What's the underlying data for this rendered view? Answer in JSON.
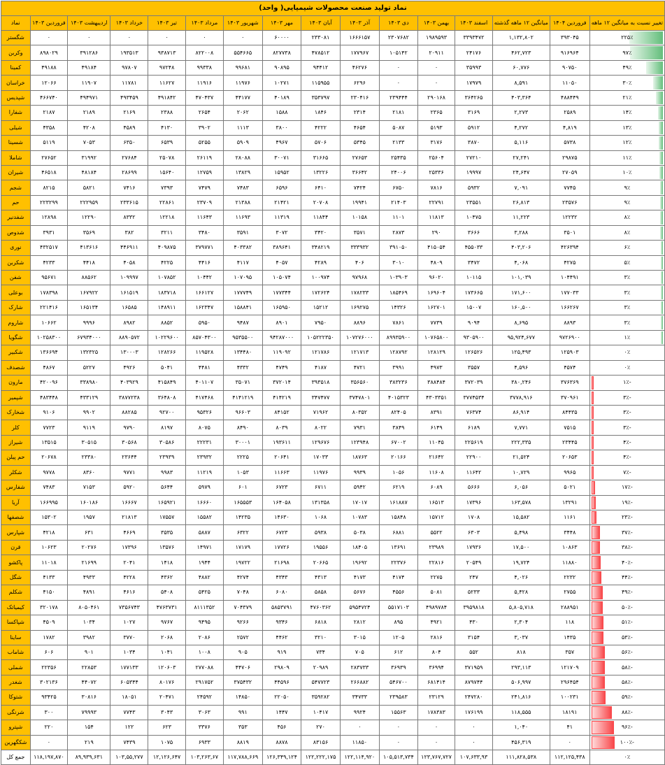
{
  "title": "نماد تولید صنعت محصولات شیمیایی( واحد)",
  "headers": [
    "تغییر نسبت به میانگین ۱۲ ماهه",
    "فروردین ۱۴۰۴",
    "میانگین ۱۲ ماهه گذشته",
    "اسفند ۱۴۰۳",
    "بهمن ۱۴۰۳",
    "دی ۱۴۰۳",
    "آذر ۱۴۰۳",
    "آبان ۱۴۰۳",
    "مهر ۱۴۰۳",
    "شهریور ۱۴۰۳",
    "مرداد ۱۴۰۳",
    "تیر ۱۴۰۳",
    "خرداد ۱۴۰۳",
    "اردیبهشت ۱۴۰۳",
    "فروردین ۱۴۰۳",
    "نماد"
  ],
  "rows": [
    {
      "change": "۲۲۵٪",
      "change_value": 225,
      "values": [
        "۳۹۳۰۴۵",
        "۱,۱۳۲,۸۰۲",
        "۳۳۹۳۴۷۲",
        "۱۹۸۹۵۹۳",
        "۲۳۰۷۶۸۲",
        "۱۶۶۶۱۵۷",
        "۲۳۳۰۸۱",
        "۶۰۰۰۰",
        "۰",
        "۰",
        "۰",
        "۰",
        "۰",
        "۰"
      ],
      "name": "شگستر"
    },
    {
      "change": "۹۷٪",
      "change_value": 97,
      "values": [
        "۹۱۶۹۶۴",
        "۴۶۲,۷۲۳",
        "۲۴۱۷۶",
        "۲۰۹۱۱",
        "۱۰۵۱۴۲",
        "۱۷۷۹۶۷",
        "۴۷۸۵۱۲",
        "۸۲۷۷۳۸",
        "۵۵۴۶۶۵",
        "۸۲۲۰۰۸",
        "۹۳۸۷۱۳",
        "۱۹۳۵۱۳",
        "۳۹۱۲۸۶",
        "۸۹۸۰۲۹"
      ],
      "name": "وکربن"
    },
    {
      "change": "۴۹٪",
      "change_value": 49,
      "values": [
        "۹۰۷۵۰",
        "۶۰,۷۷۶",
        "۳۵۹۹۳",
        "۰",
        "۰",
        "۴۶۲۷۶",
        "۹۴۴۱۲",
        "۹۰۸۹۵",
        "۹۹۶۸۱",
        "۹۹۳۳۸",
        "۹۷۲۴۸",
        "۹۷۸۰۷",
        "۴۹۱۸۴",
        "۴۹۱۸۸"
      ],
      "name": "کمینا"
    },
    {
      "change": "۳۰٪",
      "change_value": 30,
      "values": [
        "۱۱۰۵۰",
        "۸,۵۹۱",
        "۱۷۹۷۹",
        "۰",
        "۰",
        "۶۲۹۶",
        "۱۱۵۹۵۵",
        "۱۰۲۷۱",
        "۱۱۹۷۶",
        "۱۱۹۱۶",
        "۱۱۶۲۷",
        "۱۱۷۸۱",
        "۱۱۹۰۷",
        "۱۲۰۶۶"
      ],
      "name": "خراسان"
    },
    {
      "change": "۲۱٪",
      "change_value": 21,
      "values": [
        "۴۸۸۴۴۹",
        "۴۰۳,۳۶۴",
        "۳۶۴۲۶۵",
        "۲۹۰۱۶۸",
        "۲۳۹۴۴۴",
        "۲۳۰۴۱۶",
        "۳۵۳۷۹۷",
        "۴۰۱۸۹",
        "۴۴۱۷۷",
        "۴۷۰۴۳۷",
        "۴۹۱۸۴۲",
        "۴۹۳۴۵۹",
        "۴۹۴۹۷۱",
        "۴۶۶۷۴۰"
      ],
      "name": "شپدیس"
    },
    {
      "change": "۱۴٪",
      "change_value": 14,
      "values": [
        "۲۵۸۹",
        "۲,۲۷۳",
        "۳۱۶۹",
        "۲۳۶۵",
        "۲۱۸۱",
        "۲۳۱۴",
        "۱۸۴۶",
        "۱۵۸۸",
        "۲۰۶۲",
        "۲۶۵۴",
        "۲۳۸۸",
        "۲۱۶۹",
        "۲۱۸۹",
        "۲۱۸۷"
      ],
      "name": "شفارا"
    },
    {
      "change": "۱۳٪",
      "change_value": 13,
      "values": [
        "۴,۸۱۹",
        "۴,۲۷۲",
        "۵۹۱۲",
        "۵۱۹۳",
        "۵۰۸۷",
        "۴۶۵۴",
        "۴۲۲۲",
        "۳۸۰۰",
        "۱۱۱۳",
        "۳۹۰۲",
        "۴۱۳۰",
        "۴۵۸۹",
        "۴۲۰۸",
        "۴۳۵۸"
      ],
      "name": "شیلی"
    },
    {
      "change": "۱۲٪",
      "change_value": 12,
      "values": [
        "۵۷۳۸",
        "۵,۱۱۶",
        "۳۸۷۰",
        "۳۱۷۶",
        "۲۱۳۳",
        "۵۳۴۵",
        "۵۷۰۶",
        "۴۹۶۷",
        "۵۹۰۹",
        "۵۲۵۵",
        "۶۵۳۹",
        "۶۳۵۰",
        "۷۰۵۳",
        "۵۱۱۹"
      ],
      "name": "شسینا"
    },
    {
      "change": "۱۱٪",
      "change_value": 11,
      "values": [
        "۲۹۸۷۵",
        "۲۷,۲۴۱",
        "۲۷۲۱۰",
        "۲۵۶۰۴",
        "۲۵۴۳۵",
        "۲۷۶۵۳",
        "۳۱۶۶۵",
        "۳۰۰۷۱",
        "۲۸۰۸۸",
        "۲۶۱۱۹",
        "۲۵۰۷۸",
        "۲۷۶۸۴",
        "۳۱۹۹۲",
        "۲۷۶۵۲"
      ],
      "name": "شاملا"
    },
    {
      "change": "۱۰٪",
      "change_value": 10,
      "values": [
        "۲۷۰۵۹",
        "۲۴,۶۴۷",
        "۱۹۹۹۷",
        "۲۵۳۳۶",
        "۲۴۰۰۶",
        "۳۶۶۴۲",
        "۱۳۲۲۶",
        "۱۵۹۵۲",
        "۱۳۸۲۹",
        "۱۲۷۵۹",
        "۱۵۶۴۰",
        "۲۸۶۹۹",
        "۴۸۱۸۴",
        "۴۶۵۱۸"
      ],
      "name": "شیران"
    },
    {
      "change": "۹٪",
      "change_value": 9,
      "values": [
        "۷۷۴۵",
        "۷,۰۹۱",
        "۵۹۳۲",
        "۷۸۱۶",
        "۶۷۵۰",
        "۷۴۲۴",
        "۶۴۱۰",
        "۶۵۹۶",
        "۷۴۸۳",
        "۷۴۷۹",
        "۷۳۹۳",
        "۷۴۱۶",
        "۵۸۲۱",
        "۸۲۱۵"
      ],
      "name": "شجم"
    },
    {
      "change": "۹٪",
      "change_value": 9,
      "values": [
        "۲۳۵۷۶",
        "۲۶,۸۱۳",
        "۲۳۵۵۱",
        "۲۲۷۹۱",
        "۲۱۴۰۳",
        "۱۹۹۴۱",
        "۲۰۷۰۸",
        "۲۱۴۲۱",
        "۲۱۳۸۸",
        "۲۳۷۰۹",
        "۲۲۸۶۱",
        "۲۳۳۶۱۵",
        "۲۲۲۹۵۹",
        "۲۲۳۲۹۹"
      ],
      "name": "حم"
    },
    {
      "change": "۸٪",
      "change_value": 8,
      "values": [
        "۱۲۲۳۲",
        "۱۱,۲۲۳",
        "۱۰۴۷۵",
        "۱۱۸۱۳",
        "۱۱۰۱",
        "۱۰۱۵۸",
        "۱۱۸۴۴",
        "۱۱۳۱۹",
        "۱۱۶۹۳",
        "۱۱۶۴۳",
        "۱۲۲۱۸",
        "۸۳۳۲",
        "۱۲۲۹۰",
        "۱۲۸۹۸"
      ],
      "name": "شفدنیر"
    },
    {
      "change": "۸٪",
      "change_value": 8,
      "values": [
        "۳۵۰۱",
        "۳,۲۸۸",
        "۳۶۶۶",
        "۲۹۰",
        "۲۸۷۳",
        "۳۵۷۱",
        "۳۴۲۰",
        "۳۰۷۲",
        "۳۵۹۱",
        "۳۴۸۰",
        "۳۲۱۱",
        "۳۸۲",
        "۳۵۶۹",
        "۳۹۳۱"
      ],
      "name": "شدوص"
    },
    {
      "change": "۶٪",
      "change_value": 6,
      "values": [
        "۴۲۶۳۹۴",
        "۴۰۳,۲۰۶",
        "۴۵۵۰۳۳",
        "۴۱۵۰۵۴",
        "۳۹۱۰۵۰",
        "۳۳۳۹۳۲",
        "۳۴۸۲۱۹",
        "۳۸۹۶۴۱",
        "۴۰۳۳۸۲",
        "۳۷۹۷۷۱",
        "۴۰۹۸۷۵",
        "۴۴۶۹۱۱",
        "۴۱۳۶۱۶",
        "۴۳۲۵۱۷"
      ],
      "name": "نوری"
    },
    {
      "change": "۵٪",
      "change_value": 5,
      "values": [
        "۴۲۷۵",
        "۴,۰۶۸",
        "۳۴۷۲",
        "۴۸۰۹",
        "۳۰۱۰",
        "۴۰۶",
        "۴۲۸۹",
        "۴۰۵۷",
        "۴۱۱۷",
        "۴۴۱۶",
        "۴۲۲۵",
        "۴۰۵۸",
        "۴۴۱۸",
        "۴۲۳۳"
      ],
      "name": "شکربن"
    },
    {
      "change": "۳٪",
      "change_value": 3,
      "values": [
        "۱۰۴۴۹۱",
        "۱۰۱,۰۳۹",
        "۱۰۱۱۵",
        "۹۶۰۲۰",
        "۱۰۳۹۰۳",
        "۹۷۹۶۸",
        "۱۰۰۹۷۴",
        "۱۰۵۰۷۴",
        "۱۰۷۰۹۵",
        "۱۰۴۴۲",
        "۱۰۷۸۵۲",
        "۱۰۹۹۹۷",
        "۸۸۵۶۲",
        "۹۵۶۷۱"
      ],
      "name": "شفن"
    },
    {
      "change": "۳٪",
      "change_value": 3,
      "values": [
        "۱۷۷۰۳۳",
        "۱۷۱,۶۰۰",
        "۱۷۳۶۶۵",
        "۱۶۹۶۰۴",
        "۱۸۵۴۶۹",
        "۱۷۸۲۳۳",
        "۱۷۲۶۲۴",
        "۱۷۷۳۴۴",
        "۱۷۷۷۴۹",
        "۱۶۶۱۲۷",
        "۱۸۳۷۱۸",
        "۱۶۱۵۱۹",
        "۱۶۷۹۲۲",
        "۱۷۸۳۹۸"
      ],
      "name": "بوعلی"
    },
    {
      "change": "۳٪",
      "change_value": 3,
      "values": [
        "۱۶۶۲۶۷",
        "۱۶۰,۵۰۰",
        "۱۵۰۰۷",
        "۱۶۲۷۰۱",
        "۱۴۳۲۶",
        "۱۶۹۲۷۵",
        "۱۵۲۱۲",
        "۱۶۵۹۵۰",
        "۱۵۸۸۴۱",
        "۱۶۲۳۴۷",
        "۱۴۸۹۱۱",
        "۱۶۵۸۵",
        "۱۶۵۱۳۴",
        "۲۲۱۴۱۶"
      ],
      "name": "شارک"
    },
    {
      "change": "۳٪",
      "change_value": 3,
      "values": [
        "۸۸۹۳",
        "۸,۶۹۵",
        "۹۰۹۴",
        "۷۷۳۹",
        "۷۸۶۱",
        "۸۸۹۶",
        "۷۹۵۰",
        "۸۹۰۱",
        "۹۴۸۷",
        "۵۹۵۰",
        "۸۸۵۲",
        "۸۹۸۲",
        "۹۹۹۶",
        "۱۰۶۶۲"
      ],
      "name": "شاروم"
    },
    {
      "change": "۱٪",
      "change_value": 1,
      "values": [
        "۹۷۲۶۹۰۰",
        "۹۵,۹۲۴,۶۷۷",
        "۹۳۰۵۹۰۰",
        "۱۰۷۶۵۸۰۰",
        "۸۹۹۳۵۹۰۰",
        "۱۰۷۲۷۶۰۰۰",
        "۱۰۵۲۲۲۳۵۰",
        "۹۴۲۸۷۰۰۰",
        "۹۵۳۵۵۰۰",
        "۸۵۷۰۴۳۰۰",
        "۱۰۲۲۹۶۰۰",
        "۸۸۹۰۵۷۲",
        "۶۷۹۳۴۰۰۰",
        "۱۰۲۵۸۳۰۰"
      ],
      "name": "شگویا"
    },
    {
      "change": "۰٪",
      "change_value": 0,
      "values": [
        "۱۲۵۹۰۳",
        "۱۲۵,۴۹۳",
        "۱۲۶۵۲۶",
        "۱۲۸۱۲۹",
        "۱۲۸۷۹۲",
        "۱۲۱۷۱۳",
        "۱۲۱۷۸۶",
        "۱۱۹۰۹۲",
        "۱۳۴۴۸۰",
        "۱۱۹۵۲۸",
        "۱۲۸۲۶۶",
        "۱۳۰۰۰۳",
        "۱۳۲۳۲۵",
        "۱۳۶۶۹۴"
      ],
      "name": "شکبیر"
    },
    {
      "change": "۰٪",
      "change_value": 0,
      "values": [
        "۴۵۷۴",
        "۴,۵۹۶",
        "۳۵۵۷",
        "۴۹۷۳",
        "۳۹۹۱",
        "۴۷۲۱",
        "۴۱۸۷",
        "۴۷۴۹",
        "۴۳۳۲",
        "۴۴۸۱",
        "۵۰۴۱",
        "۴۹۲۶",
        "۵۲۲۷",
        "۴۸۶۷"
      ],
      "name": "شصدف"
    },
    {
      "change": "-۱٪",
      "change_value": -1,
      "values": [
        "۳۷۶۳۶۹",
        "۳۸۰,۲۴۶",
        "۳۷۲۰۳۹",
        "۳۸۸۴۸۴",
        "۳۸۳۲۳۶",
        "۳۵۶۵۶۰",
        "۳۹۳۵۱۸",
        "۳۷۲۰۱۴",
        "۳۵۰۷۱",
        "۴۰۱۱۰۷",
        "۴۱۵۸۴۹",
        "۴۰۳۹۲۹",
        "۳۳۸۹۸۰",
        "۴۲۰۰۹۶"
      ],
      "name": "مارون"
    },
    {
      "change": "-۳٪",
      "change_value": -3,
      "values": [
        "۳۷۰۹۶۱",
        "۳۷۷۸,۹۱۶",
        "۳۷۷۴۵۳۴",
        "۴۳۰۳۳۵۱",
        "۴۰۱۵۳۲۳",
        "۳۷۴۷۸۰۱",
        "۳۴۷۴۷۷",
        "۴۱۴۲۱۹",
        "۴۱۴۱۲۱۹",
        "۴۱۷۴۶۸",
        "۳۶۴۸۰۸",
        "۳۸۷۷۲۳۸",
        "۴۳۳۱۲۹",
        "۴۸۳۴۴۸"
      ],
      "name": "شپمیر"
    },
    {
      "change": "-۳٪",
      "change_value": -3,
      "values": [
        "۸۴۴۳۵",
        "۸۶,۹۱۴",
        "۷۶۳۷۴",
        "۸۳۹۱",
        "۸۲۴۰۵",
        "۸۰۳۵۲",
        "۷۱۹۶۲",
        "۸۴۱۵۲",
        "۹۶۶۰۳",
        "۹۵۳۲۶",
        "۹۲۷۰۰",
        "۸۸۲۸۵",
        "۹۹۰۲",
        "۹۱۰۶"
      ],
      "name": "شخارک"
    },
    {
      "change": "-۳٪",
      "change_value": -3,
      "values": [
        "۷۵۱۵",
        "۷,۷۷۱",
        "۶۱۸۹",
        "۶۱۴۹",
        "۳۸۴۹",
        "۷۹۳۱",
        "۸۰۲۲",
        "۸۰۳۹",
        "۸۴۹۰",
        "۸۰۷۵",
        "۸۱۹۷",
        "۹۷۹۰",
        "۹۱۱۹",
        "۷۷۲۳"
      ],
      "name": "کلر"
    },
    {
      "change": "-۴٪",
      "change_value": -4,
      "values": [
        "۲۳۴۴۵",
        "۲۲۲,۳۳۵",
        "۲۲۵۶۱۹",
        "۱۱۰۴۵",
        "۶۷۰۰۲",
        "۱۲۳۹۴۸",
        "۱۲۹۶۷۶",
        "۱۹۳۶۱۱",
        "۳۰۰۰۱",
        "۲۲۲۳۱",
        "۳۰۵۸۶",
        "۳۰۵۶۸",
        "۳۰۵۱۵",
        "۱۳۵۱۵"
      ],
      "name": "شیراز"
    },
    {
      "change": "-۴٪",
      "change_value": -4,
      "values": [
        "۲۰۶۵۳",
        "۲۱,۵۲۴",
        "۲۲۹۰۰",
        "۲۱۶۴۲",
        "۲۰۱۶۶",
        "۱۸۷۶۳",
        "۱۷۰۳۳",
        "۲۰۶۴۱",
        "۲۲۲۵",
        "۲۳۹۳۲",
        "۲۳۹۳۹",
        "۲۳۶۴۴",
        "۲۳۳۸۰",
        "۲۰۶۷۸"
      ],
      "name": "حم پیلن"
    },
    {
      "change": "-۷٪",
      "change_value": -7,
      "values": [
        "۹۹۶۵",
        "۱۰,۷۲۹",
        "۱۱۶۴۲",
        "۱۱۶۰۸",
        "۱۰۵۶",
        "۹۹۳۹",
        "۱۱۹۷۶",
        "۱۱۶۶۳",
        "۱۰۵۳",
        "۱۱۲۱۹",
        "۹۹۸۳",
        "۹۷۷۱",
        "۸۳۶۰",
        "۹۷۷۸"
      ],
      "name": "شکلر"
    },
    {
      "change": "-۱۷٪",
      "change_value": -17,
      "values": [
        "۵۰۲۱",
        "۶,۰۵۶",
        "۵۶۶۶",
        "۶۰۸۹",
        "۶۲۱۹",
        "۵۹۴۲",
        "۶۷۱۱",
        "۶۷۲۳",
        "۶۰۱",
        "۵۹۷۹",
        "۵۶۴۴",
        "۵۹۲۰",
        "۷۱۵۳",
        "۷۴۸۳"
      ],
      "name": "شفارس"
    },
    {
      "change": "-۱۹٪",
      "change_value": -19,
      "values": [
        "۱۳۲۹۱",
        "۱۶۳,۵۷۸",
        "۱۷۳۹۶",
        "۱۶۵۱۳",
        "۱۶۱۸۸۷",
        "۱۷۰۱۷",
        "۱۳۱۳۵۸",
        "۱۶۴۰۵۸",
        "۱۶۵۵۵۳",
        "۱۶۶۶۰",
        "۱۶۵۹۲۱",
        "۱۶۶۶۷",
        "۱۶۰۱۸۶",
        "۱۶۶۹۹۵"
      ],
      "name": "آریا"
    },
    {
      "change": "-۲۳٪",
      "change_value": -23,
      "values": [
        "۱۱۶۱",
        "۱۵,۵۸۲",
        "۱۷۰۸",
        "۱۵۷۱۲",
        "۱۵۸۴۸",
        "۱۰۷۸۳",
        "۱۰۶۸",
        "۱۴۶۳۰",
        "۱۴۲۳۵",
        "۱۵۵۸۲",
        "۱۷۵۵۷",
        "۲۱۸۱۳",
        "۱۹۵۷",
        "۱۵۳۰۲"
      ],
      "name": "شصفها"
    },
    {
      "change": "-۳۷٪",
      "change_value": -37,
      "values": [
        "۳۴۴۸",
        "۵,۴۹۸",
        "۶۳۰۳",
        "۵۵۲۲",
        "۶۸۸۱",
        "۵۰۳۸",
        "۵۹۳۸",
        "۶۷۲۳",
        "۶۳۲۲",
        "۵۸۸۷",
        "۳۵۳۵",
        "۴۶۶۹",
        "۶۳۱",
        "۴۲۱۸"
      ],
      "name": "شپارس"
    },
    {
      "change": "-۳۸٪",
      "change_value": -38,
      "values": [
        "۱۰۸۶۳",
        "۱۷,۵۰۰",
        "۱۷۹۳۶",
        "۲۳۹۸۹",
        "۱۳۶۹۱",
        "۱۸۴۰۵",
        "۱۹۵۵۶",
        "۱۷۷۲۶",
        "۱۷۱۷۹",
        "۱۴۹۷۱",
        "۱۳۵۷۶",
        "۱۷۳۹۶",
        "۲۰۲۷۶",
        "۱۰۶۲۳"
      ],
      "name": "قرن"
    },
    {
      "change": "-۴۰٪",
      "change_value": -40,
      "values": [
        "۱۱۸۸۰",
        "۱۹,۷۲۴",
        "۲۰۵۴۹",
        "۲۲۸۱۶",
        "۲۲۳۷۶",
        "۱۹۶۹۲",
        "۲۰۶۶۵",
        "۲۱۶۹۸",
        "۱۹۷۲۲",
        "۱۹۴۴",
        "۱۴۱۸",
        "۲۰۴۱",
        "۲۱۶۹۹",
        "۱۱۰۱۸"
      ],
      "name": "پاکشو"
    },
    {
      "change": "-۴۴٪",
      "change_value": -44,
      "values": [
        "۲۲۳۲",
        "۴,۰۲۶",
        "۲۴۷",
        "۲۲۷۵",
        "۴۱۷۴",
        "۴۱۷۳",
        "۴۳۱۳",
        "۴۳۴۳",
        "۴۲۷۴",
        "۴۸۸۲",
        "۴۳۶۲",
        "۴۲۲۸",
        "۴۹۳۳",
        "۴۱۳۳"
      ],
      "name": "شگل"
    },
    {
      "change": "-۴۹٪",
      "change_value": -49,
      "values": [
        "۲۷۵۵",
        "۵,۴۲۸",
        "۵۲۳۳",
        "۵۰۸۱",
        "۴۵۵۶",
        "۵۶۷۶",
        "۵۸۵۸",
        "۶۰۸۰",
        "۷۰۴۸",
        "۵۴۲۵",
        "۵۴۰۸",
        "۴۶۱۶",
        "۴۸۹۱",
        "۴۱۵۰"
      ],
      "name": "شکلم"
    },
    {
      "change": "-۵۰٪",
      "change_value": -50,
      "values": [
        "۲۸۸۹۵۱",
        "۵,۸۰۵,۷۱۸",
        "۳۹۵۹۸۱۸",
        "۴۹۸۹۷۸۴",
        "۵۵۱۷۱۰۳",
        "۵۹۵۴۷۲۴",
        "۴۷۶۰۳۶۲",
        "۵۸۵۳۷۹۱",
        "۷۰۴۳۷۹",
        "۸۱۱۱۳۵۲",
        "۴۷۶۳۷۳۱",
        "۷۳۵۶۷۴۳",
        "۸۰۵۰۴۶۱",
        "۳۲۰۱۷۸"
      ],
      "name": "کیمیاتک"
    },
    {
      "change": "-۵۱٪",
      "change_value": -51,
      "values": [
        "۱۱۸",
        "۲,۳۰۴",
        "۴۳۰",
        "۴۹۲۱",
        "۸۹۵",
        "۲۸۱۲",
        "۶۸۱۸",
        "۹۳۴۶",
        "۹۲۶۶",
        "۹۴۹۵",
        "۹۷۶۷",
        "۱۰۲۷",
        "۱۰۳۴",
        "۴۵۰۹"
      ],
      "name": "شپاکسا"
    },
    {
      "change": "-۵۳٪",
      "change_value": -53,
      "values": [
        "۱۴۳۵",
        "۳,۰۳۷",
        "۳۱۵۴",
        "۲۸۱۶",
        "۱۲۰۵",
        "۳۰۱۵",
        "۳۲۱۰",
        "۴۴۶۲",
        "۲۵۷۲",
        "۲۰۸۶",
        "۲۰۶۸",
        "۳۷۷۰",
        "۳۹۸۲",
        "۱۷۸۲"
      ],
      "name": "ساینا"
    },
    {
      "change": "-۵۶٪",
      "change_value": -56,
      "values": [
        "۳۵۷",
        "۸۱۸",
        "۵۵۲",
        "۸۰۴",
        "۶۱۲",
        "۷۰۵",
        "۷۳۴",
        "۹۱۹",
        "۹۰۵",
        "۱۰۰۸",
        "۱۰۴۱",
        "۱۰۳۴",
        "۹۰۱",
        "۶۰۶"
      ],
      "name": "شاماب"
    },
    {
      "change": "-۵۸٪",
      "change_value": -58,
      "values": [
        "۱۲۱۷۰۹",
        "۲۹۳,۱۱۳",
        "۳۷۱۹۵۹",
        "۳۶۹۹۴",
        "۳۶۹۳۹",
        "۲۸۳۷۳۳",
        "۲۰۹۸۹",
        "۲۹۸۰۹",
        "۴۴۷۰۶",
        "۲۷۷۰۸۸",
        "۱۲۰۶۰۳",
        "۱۷۷۱۳۳",
        "۲۲۸۵۳",
        "۲۲۳۵۶"
      ],
      "name": "شملی"
    },
    {
      "change": "-۵۸٪",
      "change_value": -58,
      "values": [
        "۲۹۶۴۵۴",
        "۵۰۶,۹۹۷",
        "۸۷۹۷۴۴",
        "۶۸۱۴۱۴",
        "۵۴۶۷۰۰",
        "۲۶۶۸۸۲",
        "۵۴۷۷۲۳",
        "۴۴۵۹۶",
        "۳۷۵۴۳۲",
        "۲۹۱۷۵۲",
        "۸۰۱۷۶",
        "۶۰۵۳۴۴",
        "۴۴۰۷۲",
        "۳۰۲۱۳۶"
      ],
      "name": "شغدر"
    },
    {
      "change": "-۵۹٪",
      "change_value": -59,
      "values": [
        "۱۰۰۲۳۱",
        "۲۴۱,۸۱۶",
        "۲۴۷۲۸۰",
        "۲۳۱۲۹",
        "۲۳۹۵۸۳",
        "۳۴۷۳۳",
        "۳۵۹۲۸۲",
        "۲۲۰۵۰",
        "۱۴۸۵۰",
        "۲۴۵۹۲",
        "۲۰۴۷۱",
        "۱۸۰۵۱",
        "۳۰۸۱۶",
        "۹۳۴۲۵"
      ],
      "name": "شتوکا"
    },
    {
      "change": "-۸۸٪",
      "change_value": -88,
      "values": [
        "۱۸۱۹۱",
        "۱۱۸,۵۵۵",
        "۱۷۶۱۹۹",
        "۱۷۸۳۸۳",
        "۱۵۵۶۳",
        "۹۹۲۴",
        "۱۰۴۱۷",
        "۱۴۴۷",
        "۹۹۱",
        "۳۰۶۳",
        "۳۰۴۳",
        "۷۷۴۳",
        "۷۹۹۹۳",
        "۳۰۰"
      ],
      "name": "شرنگی"
    },
    {
      "change": "-۹۶٪",
      "change_value": -96,
      "values": [
        "۴۱",
        "۱,۰۴۰",
        "۰",
        "۰",
        "۰",
        "۰",
        "۲۷۰",
        "۴۵۶",
        "۳۵۳",
        "۳۳۷۶",
        "۶۲۳",
        "۱۲۲",
        "۱۵۴",
        "۲۲۰"
      ],
      "name": "شپترو"
    },
    {
      "change": "-۱۰۰٪",
      "change_value": -100,
      "values": [
        "۰",
        "۴۵۶,۳۱۹",
        "۰",
        "۰",
        "۰",
        "۱۱۸۵۰",
        "۸۳۱۵۶",
        "۸۸۷۸",
        "۸۸۱۹",
        "۶۹۳۳",
        "۱۰۷۵",
        "۷۴۳۹",
        "۲۱۹",
        "۰"
      ],
      "name": "شکگهرین"
    }
  ],
  "total": {
    "change": "۰٪",
    "values": [
      "۱۱۲,۱۲۵,۴۳۸",
      "۱۱۱,۸۲۸,۵۳۸",
      "۱۰۷,۶۳۳,۹۳",
      "۱۲۳,۷۶۷,۷۲۷",
      "۱۰۵,۵۱۳,۷۳۴",
      "۱۲۲,۱۱۴,۹۲۰",
      "۱۲۲,۲۲۲,۱۷۵",
      "۱۲۶,۳۴۹,۱۲۴",
      "۱۱۷,۷۸۸,۶۶۹",
      "۱۰۳,۲۶۳,۶۷",
      "۱۲,۱۲۶,۶۴۷",
      "۱۰۳,۵۵,۲۷۷",
      "۸۹,۹۳۹,۶۳۱",
      "۱۱۸,۱۹۷,۸۷۰"
    ],
    "name": "جمع کل"
  },
  "colors": {
    "header_bg": "#ffc000",
    "bar_positive": "#63be7b",
    "bar_negative": "#f8484b",
    "grid": "#7a7a7a"
  }
}
